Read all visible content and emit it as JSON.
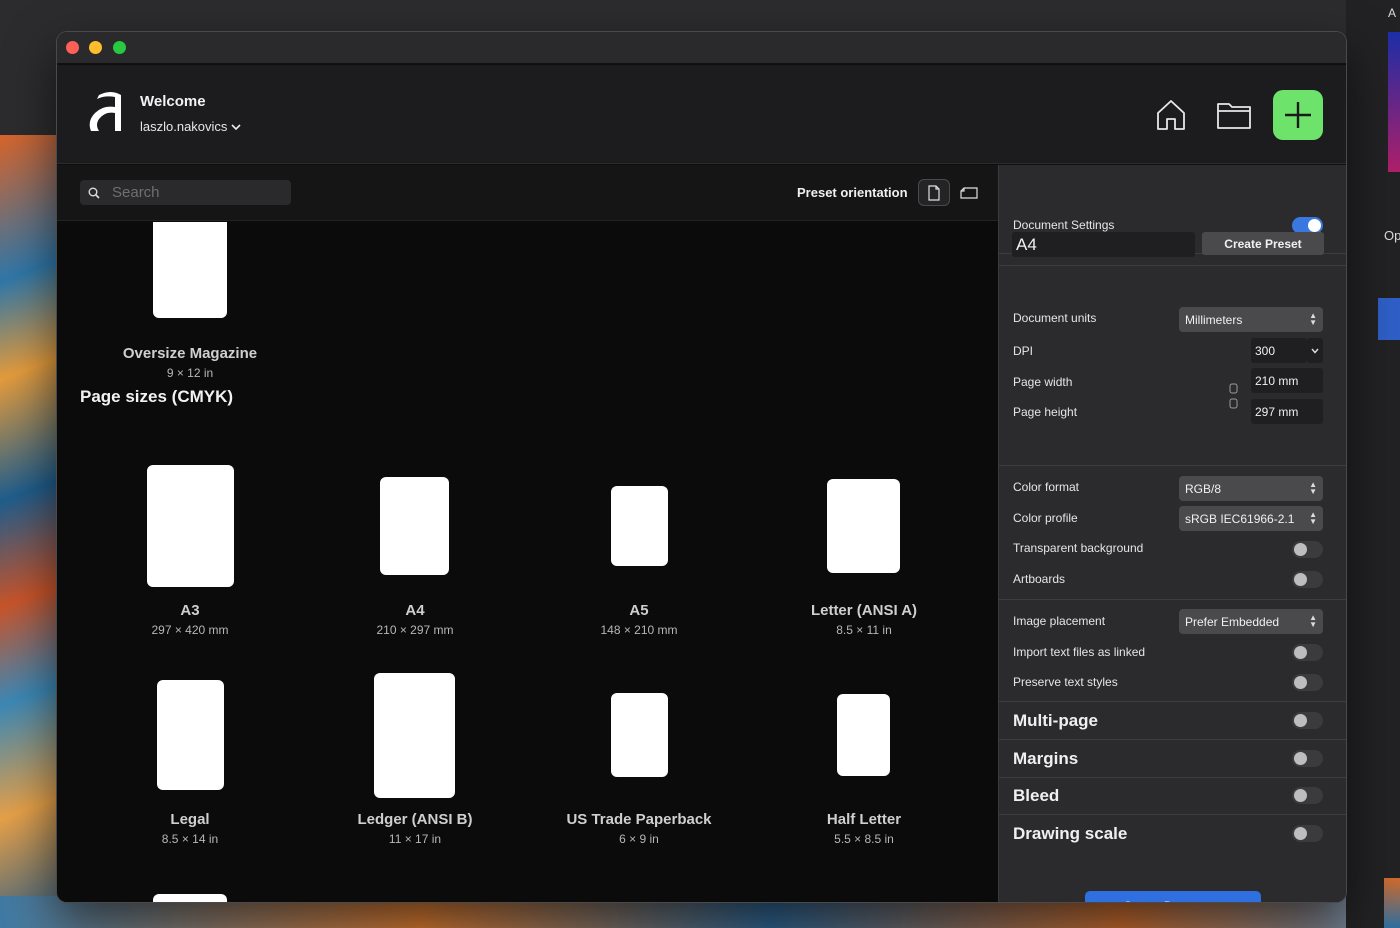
{
  "header": {
    "title": "Welcome",
    "user": "laszlo.nakovics"
  },
  "toolbar": {
    "search_placeholder": "Search",
    "preset_orientation_label": "Preset orientation"
  },
  "documents": {
    "partial_top": {
      "name": "Oversize Magazine",
      "size": "9 × 12 in"
    },
    "section_title": "Page sizes (CMYK)",
    "items": [
      {
        "name": "A3",
        "size": "297 × 420 mm"
      },
      {
        "name": "A4",
        "size": "210 × 297 mm"
      },
      {
        "name": "A5",
        "size": "148 × 210 mm"
      },
      {
        "name": "Letter (ANSI A)",
        "size": "8.5 × 11 in"
      },
      {
        "name": "Legal",
        "size": "8.5 × 14 in"
      },
      {
        "name": "Ledger (ANSI B)",
        "size": "11 × 17 in"
      },
      {
        "name": "US Trade Paperback",
        "size": "6 × 9 in"
      },
      {
        "name": "Half Letter",
        "size": "5.5 × 8.5 in"
      }
    ]
  },
  "settings": {
    "title": "Document Settings",
    "preset_name": "A4",
    "create_preset": "Create Preset",
    "document_units_label": "Document units",
    "document_units_value": "Millimeters",
    "dpi_label": "DPI",
    "dpi_value": "300",
    "page_width_label": "Page width",
    "page_width_value": "210 mm",
    "page_height_label": "Page height",
    "page_height_value": "297 mm",
    "color_format_label": "Color format",
    "color_format_value": "RGB/8",
    "color_profile_label": "Color profile",
    "color_profile_value": "sRGB IEC61966-2.1",
    "transparent_bg_label": "Transparent background",
    "artboards_label": "Artboards",
    "image_placement_label": "Image placement",
    "image_placement_value": "Prefer Embedded",
    "import_text_label": "Import text files as linked",
    "preserve_text_label": "Preserve text styles",
    "multipage_label": "Multi-page",
    "margins_label": "Margins",
    "bleed_label": "Bleed",
    "drawing_scale_label": "Drawing scale",
    "create_document": "Create Document"
  },
  "desktop": {
    "right_edge_text_top": "A",
    "right_edge_text_op": "Op"
  },
  "colors": {
    "accent_green": "#6ee36b",
    "accent_blue": "#2f6fe0"
  }
}
